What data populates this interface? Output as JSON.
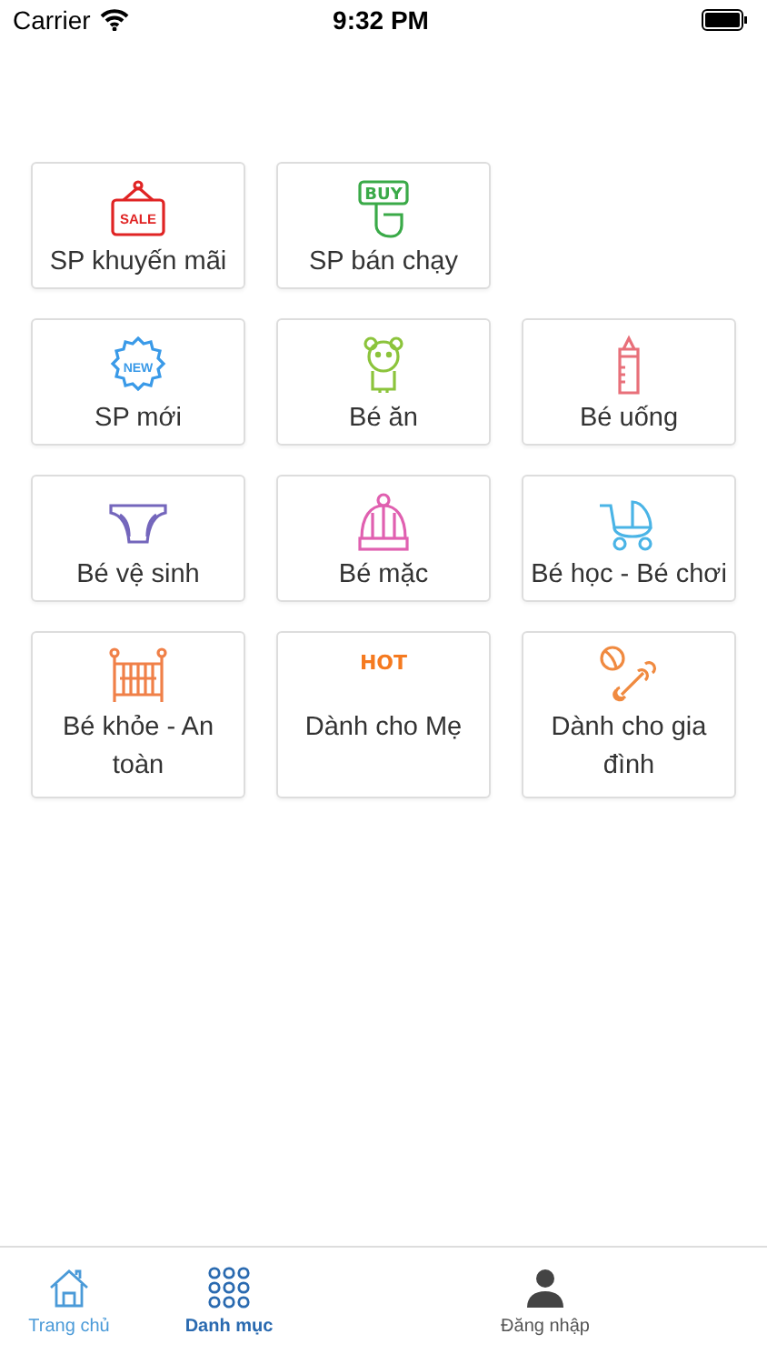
{
  "status_bar": {
    "carrier": "Carrier",
    "time": "9:32 PM"
  },
  "featured": [
    {
      "label": "SP khuyến mãi",
      "kind": "sale",
      "icon_text": "SALE",
      "color": "#e02424"
    },
    {
      "label": "SP bán chạy",
      "kind": "buy",
      "icon_text": "BUY",
      "color": "#3aaa48"
    }
  ],
  "categories": [
    {
      "label": "SP mới",
      "kind": "new",
      "icon_text": "NEW",
      "color": "#3a9ae8"
    },
    {
      "label": "Bé ăn",
      "kind": "bear",
      "color": "#8cc43c"
    },
    {
      "label": "Bé uống",
      "kind": "bottle",
      "color": "#e8707a"
    },
    {
      "label": "Bé vệ sinh",
      "kind": "diaper",
      "color": "#7466bc"
    },
    {
      "label": "Bé mặc",
      "kind": "hat",
      "color": "#e060b0"
    },
    {
      "label": "Bé học - Bé chơi",
      "kind": "stroller",
      "color": "#4ab4e6"
    },
    {
      "label": "Bé khỏe - An toàn",
      "kind": "crib",
      "color": "#f08048"
    },
    {
      "label": "Dành cho Mẹ",
      "kind": "hot",
      "icon_text": "HOT",
      "color": "#f57a20"
    },
    {
      "label": "Dành cho gia đình",
      "kind": "bone",
      "color": "#f08a40"
    }
  ],
  "tab_bar": [
    {
      "label": "Trang chủ",
      "kind": "home",
      "selected": false,
      "color": "#4a9ad8"
    },
    {
      "label": "Danh mục",
      "kind": "grid",
      "selected": true,
      "color": "#2a6ab0"
    },
    {
      "label": "Đăng nhập",
      "kind": "person",
      "selected": false,
      "color": "#555555"
    }
  ]
}
